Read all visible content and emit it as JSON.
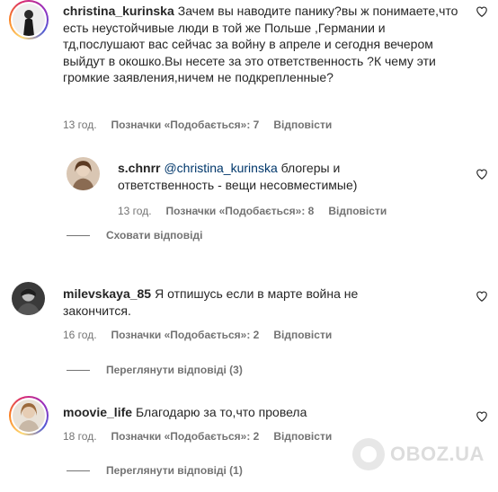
{
  "comments": [
    {
      "username": "christina_kurinska",
      "text": "Зачем вы наводите панику?вы ж понимаете,что есть неустойчивые люди в той же Польше ,Германии и тд,послушают вас сейчас за войну в апреле и сегодня вечером выйдут в окошко.Вы несете за это ответственность ?К чему эти громкие заявления,ничем не подкрепленные?",
      "time": "13 год.",
      "likes": "Позначки «Подобається»: 7",
      "reply": "Відповісти",
      "replies_toggle": "Сховати відповіді"
    },
    {
      "username": "s.chnrr",
      "mention": "@christina_kurinska",
      "text": " блогеры и ответственность - вещи несовместимые)",
      "time": "13 год.",
      "likes": "Позначки «Подобається»: 8",
      "reply": "Відповісти"
    },
    {
      "username": "milevskaya_85",
      "text": "Я отпишусь если в марте война не закончится.",
      "time": "16 год.",
      "likes": "Позначки «Подобається»: 2",
      "reply": "Відповісти",
      "replies_toggle": "Переглянути відповіді (3)"
    },
    {
      "username": "moovie_life",
      "text": "Благодарю за то,что провела",
      "time": "18 год.",
      "likes": "Позначки «Подобається»: 2",
      "reply": "Відповісти",
      "replies_toggle": "Переглянути відповіді (1)"
    }
  ],
  "watermark": "OBOZ.UA",
  "icons": {
    "like": "heart-outline-icon",
    "avatar": "avatar"
  },
  "colors": {
    "text": "#262626",
    "secondary": "#737373",
    "mention": "#00376b"
  }
}
